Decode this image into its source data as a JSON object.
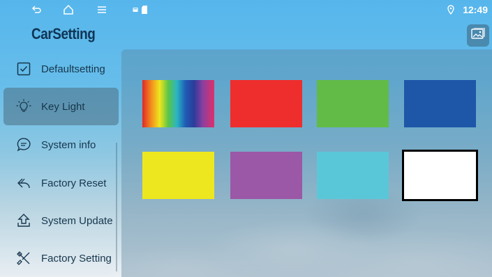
{
  "status_bar": {
    "time": "12:49",
    "icons": [
      "back-icon",
      "home-icon",
      "menu-icon",
      "notification-icon",
      "sd-card-icon",
      "location-icon"
    ]
  },
  "app": {
    "title": "CarSetting",
    "wallpaper_icon": "wallpaper-icon"
  },
  "sidebar": {
    "items": [
      {
        "label": "Defaultsetting",
        "icon": "checkbox-icon",
        "active": false
      },
      {
        "label": "Key Light",
        "icon": "bulb-icon",
        "active": true
      },
      {
        "label": "System info",
        "icon": "chat-icon",
        "active": false
      },
      {
        "label": "Factory Reset",
        "icon": "reset-icon",
        "active": false
      },
      {
        "label": "System Update",
        "icon": "upload-icon",
        "active": false
      },
      {
        "label": "Factory Setting",
        "icon": "tools-icon",
        "active": false
      }
    ]
  },
  "colors": {
    "swatches": [
      {
        "name": "rainbow",
        "color": "rainbow",
        "selected": false
      },
      {
        "name": "red",
        "color": "#ee2d2d",
        "selected": false
      },
      {
        "name": "green",
        "color": "#62bb47",
        "selected": false
      },
      {
        "name": "blue",
        "color": "#1e56a8",
        "selected": false
      },
      {
        "name": "yellow",
        "color": "#ede720",
        "selected": false
      },
      {
        "name": "purple",
        "color": "#9b58a6",
        "selected": false
      },
      {
        "name": "cyan",
        "color": "#5ac7d8",
        "selected": false
      },
      {
        "name": "white",
        "color": "#ffffff",
        "selected": true
      }
    ]
  }
}
